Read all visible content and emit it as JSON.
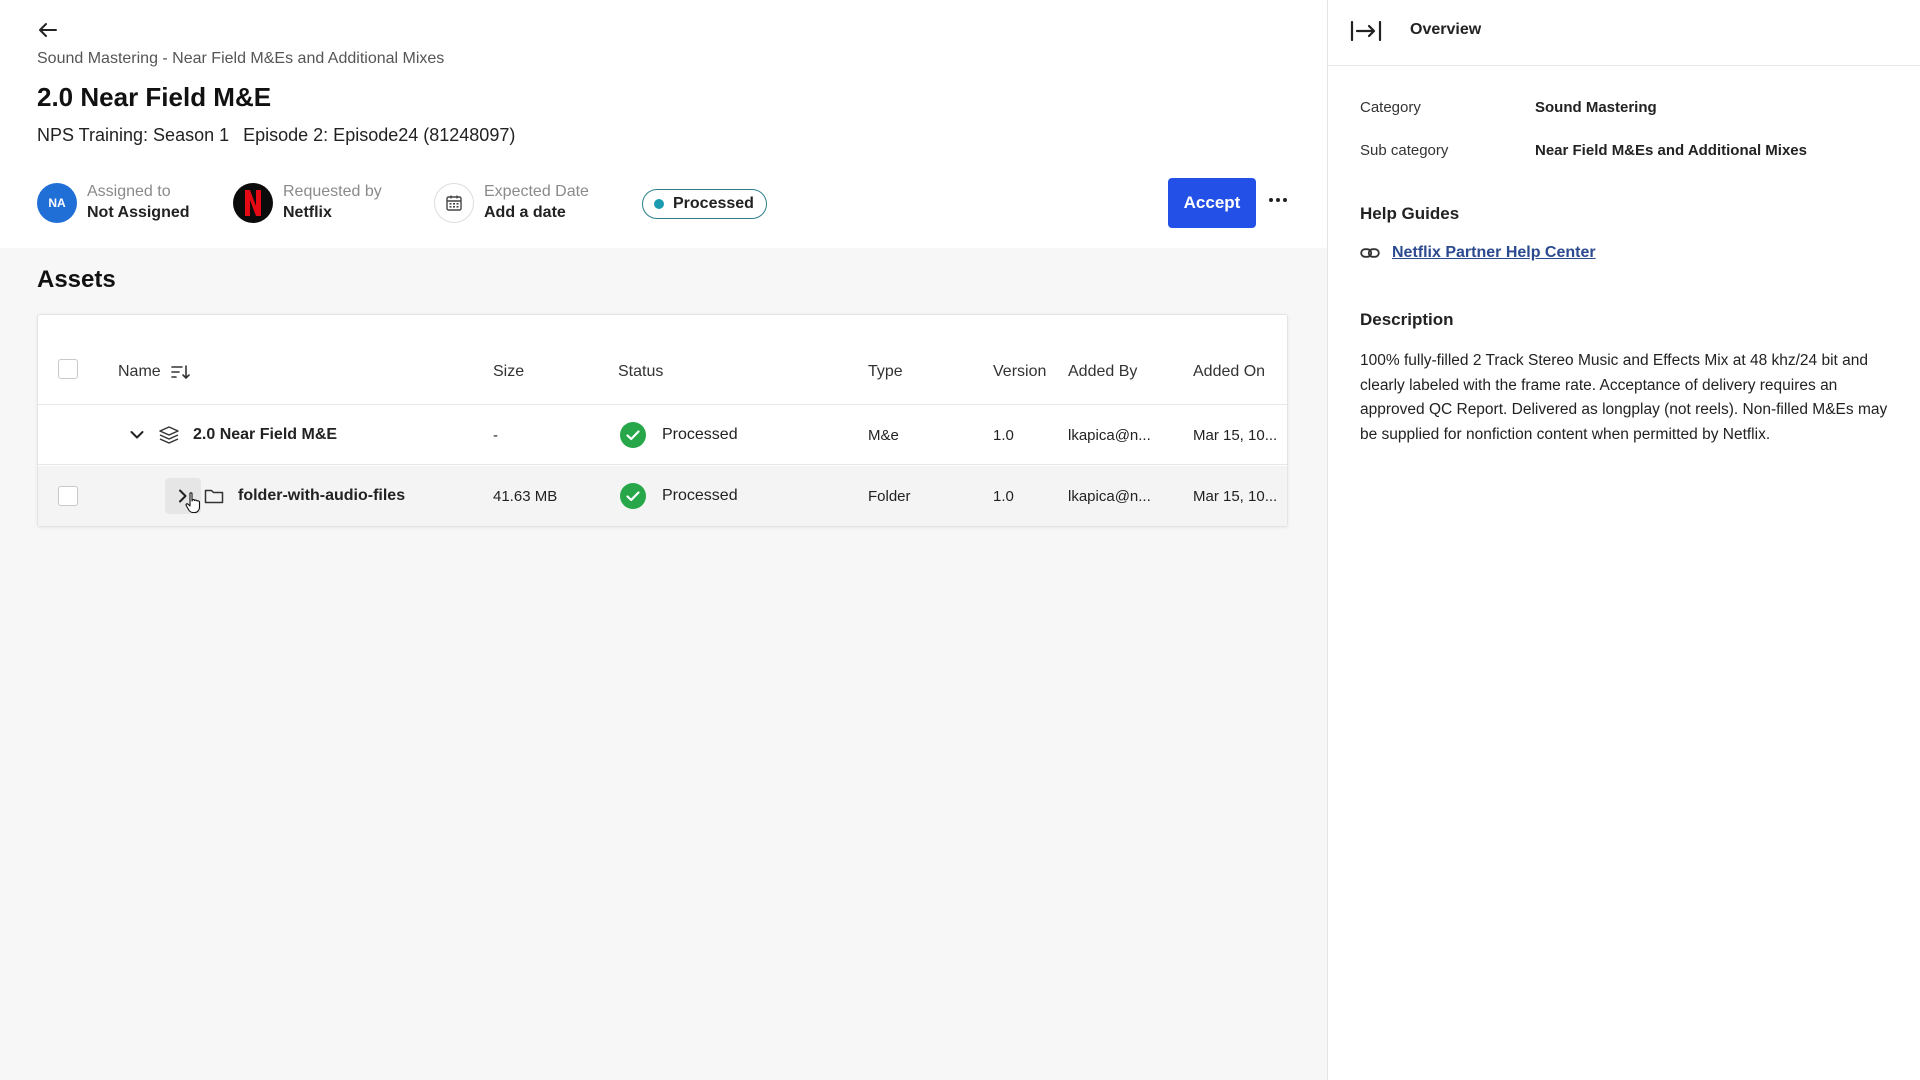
{
  "breadcrumb": "Sound Mastering - Near Field M&Es and Additional Mixes",
  "title": "2.0 Near Field M&E",
  "subtitle": {
    "season": "NPS Training: Season 1",
    "episode": "Episode 2: Episode24 (81248097)"
  },
  "assigned": {
    "label": "Assigned to",
    "value": "Not Assigned",
    "initials": "NA"
  },
  "requested": {
    "label": "Requested by",
    "value": "Netflix"
  },
  "expected": {
    "label": "Expected Date",
    "value": "Add a date"
  },
  "status": "Processed",
  "accept_label": "Accept",
  "assets": {
    "title": "Assets",
    "columns": [
      "Name",
      "Size",
      "Status",
      "Type",
      "Version",
      "Added By",
      "Added On"
    ],
    "rows": [
      {
        "name": "2.0 Near Field M&E",
        "size": "-",
        "status": "Processed",
        "type": "M&e",
        "version": "1.0",
        "added_by": "lkapica@n...",
        "added_on": "Mar 15, 10..."
      },
      {
        "name": "folder-with-audio-files",
        "size": "41.63 MB",
        "status": "Processed",
        "type": "Folder",
        "version": "1.0",
        "added_by": "lkapica@n...",
        "added_on": "Mar 15, 10..."
      }
    ]
  },
  "panel": {
    "title": "Overview",
    "category_label": "Category",
    "category_value": "Sound Mastering",
    "subcategory_label": "Sub category",
    "subcategory_value": "Near Field M&Es and Additional Mixes",
    "help_title": "Help Guides",
    "help_link": "Netflix Partner Help Center",
    "description_title": "Description",
    "description": "100% fully-filled 2 Track Stereo Music and Effects Mix at 48 khz/24 bit and clearly labeled with the frame rate. Acceptance of delivery requires an approved QC Report. Delivered as longplay (not reels). Non-filled M&Es may be supplied for nonfiction content when permitted by Netflix."
  },
  "colors": {
    "accent": "#2350e6",
    "success": "#27a74a",
    "status_dot": "#1a9bb0",
    "link": "#2b4a8f"
  }
}
